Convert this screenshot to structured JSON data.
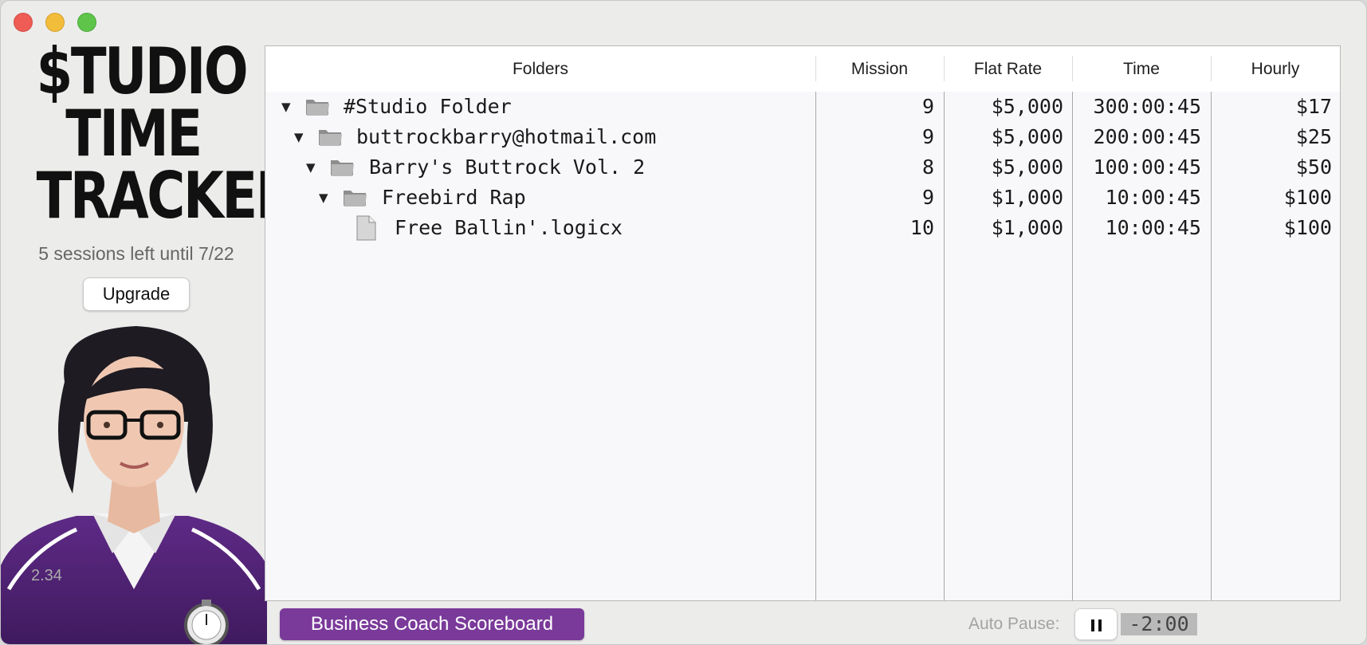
{
  "app": {
    "logo_lines": [
      "$TUDIO",
      "TIME",
      "TRACKER"
    ],
    "sessions_text": "5 sessions left until 7/22",
    "upgrade_label": "Upgrade",
    "version": "2.34",
    "accent_color": "#7a3a9a"
  },
  "table": {
    "columns": [
      "Folders",
      "Mission",
      "Flat Rate",
      "Time",
      "Hourly"
    ],
    "rows": [
      {
        "name": "#Studio Folder",
        "kind": "folder",
        "mission": "9",
        "flat_rate": "$5,000",
        "time": "300:00:45",
        "hourly": "$17"
      },
      {
        "name": "buttrockbarry@hotmail.com",
        "kind": "folder",
        "mission": "9",
        "flat_rate": "$5,000",
        "time": "200:00:45",
        "hourly": "$25"
      },
      {
        "name": "Barry's Buttrock Vol. 2",
        "kind": "folder",
        "mission": "8",
        "flat_rate": "$5,000",
        "time": "100:00:45",
        "hourly": "$50"
      },
      {
        "name": "Freebird Rap",
        "kind": "folder",
        "mission": "9",
        "flat_rate": "$1,000",
        "time": "10:00:45",
        "hourly": "$100"
      },
      {
        "name": "Free Ballin'.logicx",
        "kind": "file",
        "mission": "10",
        "flat_rate": "$1,000",
        "time": "10:00:45",
        "hourly": "$100"
      }
    ]
  },
  "footer": {
    "scoreboard_label": "Business Coach Scoreboard",
    "auto_pause_label": "Auto Pause:",
    "countdown": "-2:00"
  }
}
